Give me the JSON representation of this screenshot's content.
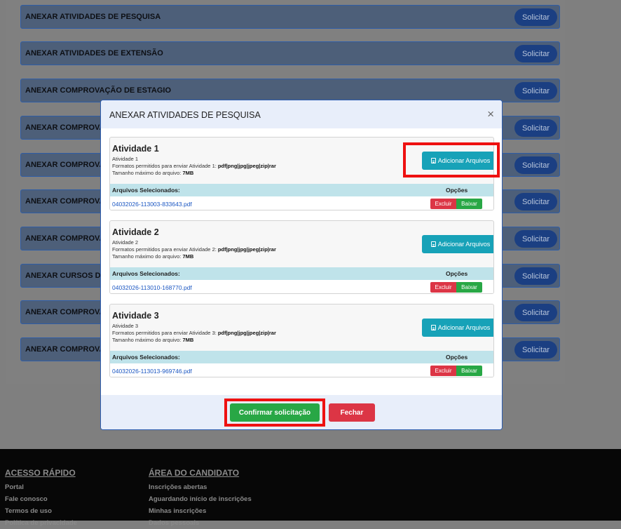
{
  "background_rows": [
    {
      "label": "ANEXAR ATIVIDADES DE PESQUISA",
      "button": "Solicitar"
    },
    {
      "label": "ANEXAR ATIVIDADES DE EXTENSÃO",
      "button": "Solicitar"
    },
    {
      "label": "ANEXAR COMPROVAÇÃO DE ESTAGIO",
      "button": "Solicitar"
    },
    {
      "label": "ANEXAR COMPROVAÇÃ",
      "button": "Solicitar"
    },
    {
      "label": "ANEXAR COMPROVAÇÃ",
      "button": "Solicitar"
    },
    {
      "label": "ANEXAR COMPROVAÇÃ",
      "button": "Solicitar"
    },
    {
      "label": "ANEXAR COMPROVAÇÃ",
      "button": "Solicitar"
    },
    {
      "label": "ANEXAR CURSOS DE CAP",
      "button": "Solicitar"
    },
    {
      "label": "ANEXAR COMPROVAÇÃ",
      "button": "Solicitar"
    },
    {
      "label": "ANEXAR COMPROVAÇÃ",
      "button": "Solicitar"
    }
  ],
  "modal": {
    "title": "ANEXAR ATIVIDADES DE PESQUISA",
    "close_symbol": "×",
    "add_button_label": "Adicionar Arquivos",
    "selected_header": "Arquivos Selecionados:",
    "options_header": "Opções",
    "delete_label": "Excluir",
    "download_label": "Baixar",
    "max_size_prefix": "Tamanho máximo do arquivo: ",
    "max_size_value": "7MB",
    "activities": [
      {
        "title": "Atividade 1",
        "subtitle": "Atividade 1",
        "formats_prefix": "Formatos permitidos para enviar Atividade 1: ",
        "formats": "pdf|png|jpg|jpeg|zip|rar",
        "file": "04032026-113003-833643.pdf"
      },
      {
        "title": "Atividade 2",
        "subtitle": "Atividade 2",
        "formats_prefix": "Formatos permitidos para enviar Atividade 2: ",
        "formats": "pdf|png|jpg|jpeg|zip|rar",
        "file": "04032026-113010-168770.pdf"
      },
      {
        "title": "Atividade 3",
        "subtitle": "Atividade 3",
        "formats_prefix": "Formatos permitidos para enviar Atividade 3: ",
        "formats": "pdf|png|jpg|jpeg|zip|rar",
        "file": "04032026-113013-969746.pdf"
      }
    ],
    "confirm_label": "Confirmar solicitação",
    "close_label": "Fechar"
  },
  "footer": {
    "quick_access": {
      "title": "ACESSO RÁPIDO",
      "links": [
        "Portal",
        "Fale conosco",
        "Termos de uso",
        "Política de privacidade"
      ]
    },
    "candidate_area": {
      "title": "ÁREA DO CANDIDATO",
      "links": [
        "Inscrições abertas",
        "Aguardando início de inscrições",
        "Minhas inscrições",
        "Dados pessoais"
      ]
    }
  },
  "colors": {
    "highlight": "#ee1111",
    "info_button": "#17a2b8",
    "confirm_button": "#28a745",
    "danger_button": "#dc3545",
    "solicitar_button": "#1b3f82"
  }
}
